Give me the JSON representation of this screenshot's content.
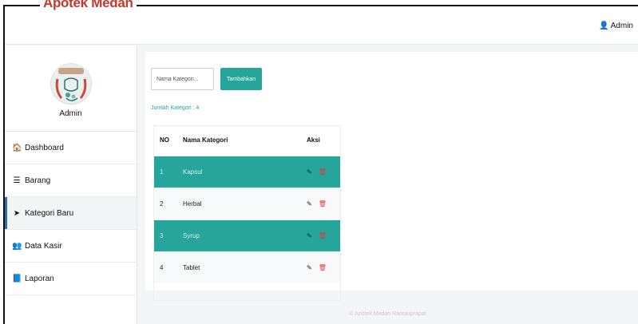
{
  "brand": "Apotek Medan",
  "topbar": {
    "user_label": "Admin"
  },
  "sidebar": {
    "profile_name": "Admin",
    "items": [
      {
        "label": "Dashboard",
        "icon": "home-icon"
      },
      {
        "label": "Barang",
        "icon": "bars-icon"
      },
      {
        "label": "Kategori Baru",
        "icon": "tag-icon"
      },
      {
        "label": "Data Kasir",
        "icon": "users-icon"
      },
      {
        "label": "Laporan",
        "icon": "book-icon"
      }
    ],
    "active_index": 2
  },
  "form": {
    "input_placeholder": "Nama Kategori...",
    "input_value": "",
    "submit_label": "Tambahkan"
  },
  "count_label": "Jumlah Kategori : 4",
  "table": {
    "headers": [
      "NO",
      "Nama Kategori",
      "Aksi"
    ],
    "rows": [
      {
        "no": "1",
        "name": "Kapsul"
      },
      {
        "no": "2",
        "name": "Herbal"
      },
      {
        "no": "3",
        "name": "Syrup"
      },
      {
        "no": "4",
        "name": "Tablet"
      }
    ]
  },
  "footer": "© Apotek Medan Rantauprapat",
  "colors": {
    "accent": "#26a69a",
    "brand": "#c0392b",
    "delete": "#e53935",
    "active_indicator": "#2b6cb0"
  }
}
